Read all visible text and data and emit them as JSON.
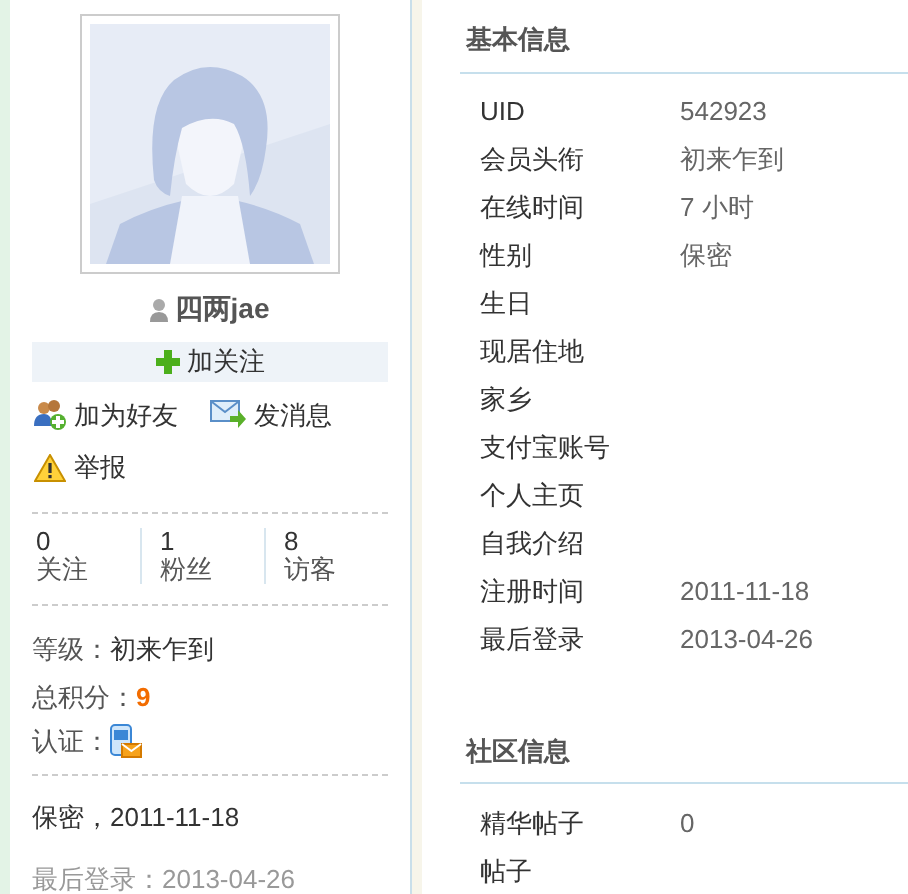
{
  "profile": {
    "username": "四两jae",
    "follow_button": "加关注",
    "actions": [
      {
        "kind": "add-friend",
        "label": "加为好友"
      },
      {
        "kind": "message",
        "label": "发消息"
      },
      {
        "kind": "report",
        "label": "举报"
      }
    ],
    "stats": [
      {
        "value": "0",
        "label": "关注"
      },
      {
        "value": "1",
        "label": "粉丝"
      },
      {
        "value": "8",
        "label": "访客"
      }
    ],
    "level": {
      "label": "等级：",
      "value": "初来乍到"
    },
    "points": {
      "label": "总积分：",
      "value": "9"
    },
    "verification": {
      "label": "认证："
    },
    "registered": "保密，2011-11-18",
    "last_login": "最后登录：2013-04-26"
  },
  "sections": [
    {
      "title": "基本信息",
      "rows": [
        {
          "label": "UID",
          "value": "542923"
        },
        {
          "label": "会员头衔",
          "value": "初来乍到"
        },
        {
          "label": "在线时间",
          "value": "7 小时"
        },
        {
          "label": "性别",
          "value": "保密"
        },
        {
          "label": "生日"
        },
        {
          "label": "现居住地"
        },
        {
          "label": "家乡"
        },
        {
          "label": "支付宝账号"
        },
        {
          "label": "个人主页"
        },
        {
          "label": "自我介绍"
        },
        {
          "label": "注册时间",
          "value": "2011-11-18"
        },
        {
          "label": "最后登录",
          "value": "2013-04-26"
        }
      ]
    },
    {
      "title": "社区信息",
      "rows": [
        {
          "label": "精华帖子",
          "value": "0"
        },
        {
          "label": "帖子"
        }
      ]
    }
  ]
}
